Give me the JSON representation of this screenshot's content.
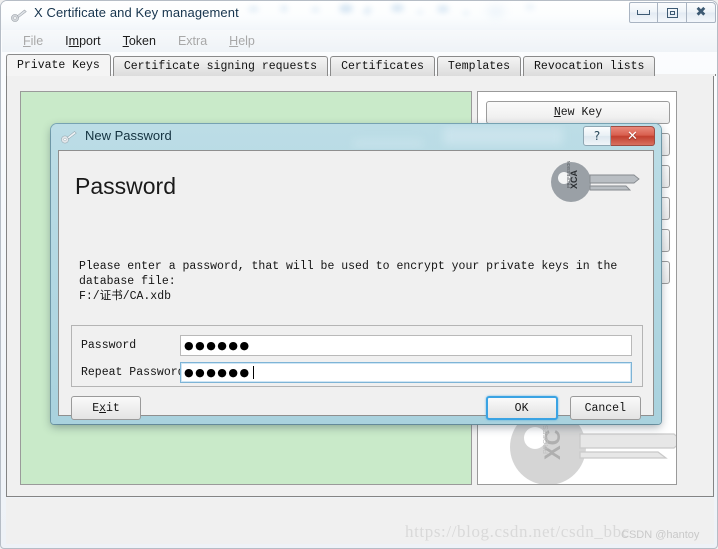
{
  "window": {
    "title": "X Certificate and Key management",
    "icon": "key-icon",
    "controls": {
      "minimize": "minimize-icon",
      "maximize": "maximize-icon",
      "close": "close-icon"
    }
  },
  "menubar": {
    "items": [
      {
        "label": "File",
        "mnemonic": "F",
        "enabled": false
      },
      {
        "label": "Import",
        "mnemonic": "m",
        "enabled": true
      },
      {
        "label": "Token",
        "mnemonic": "T",
        "enabled": true
      },
      {
        "label": "Extra",
        "mnemonic": "E",
        "enabled": false
      },
      {
        "label": "Help",
        "mnemonic": "H",
        "enabled": false
      }
    ]
  },
  "tabs": [
    {
      "label": "Private Keys",
      "active": true
    },
    {
      "label": "Certificate signing requests",
      "active": false
    },
    {
      "label": "Certificates",
      "active": false
    },
    {
      "label": "Templates",
      "active": false
    },
    {
      "label": "Revocation lists",
      "active": false
    }
  ],
  "main": {
    "key_list": {
      "name": "private-key-list",
      "items": [],
      "background": "#c9eac9"
    },
    "side_buttons": [
      {
        "label": "New Key",
        "mnemonic": "N",
        "visible": true
      },
      {
        "label": "",
        "visible": false
      },
      {
        "label": "",
        "visible": false
      },
      {
        "label": "",
        "visible": false
      },
      {
        "label": "",
        "visible": false
      },
      {
        "label": "",
        "visible": false
      }
    ],
    "watermark_graphic": "xca-key-graphic"
  },
  "dialog": {
    "title": "New Password",
    "icon": "key-icon",
    "help_button": "?",
    "close_button": "✕",
    "heading": "Password",
    "header_icon": "xca-key-icon",
    "description": "Please enter a password, that will be used to encrypt your private keys in the database file:\nF:/证书/CA.xdb",
    "fields": [
      {
        "label": "Password",
        "value": "●●●●●●",
        "char_count": 6,
        "focused": false
      },
      {
        "label": "Repeat Password",
        "value": "●●●●●●",
        "char_count": 6,
        "focused": true
      }
    ],
    "buttons": {
      "exit": {
        "label": "Exit",
        "mnemonic": "x",
        "default": false
      },
      "ok": {
        "label": "OK",
        "default": true
      },
      "cancel": {
        "label": "Cancel",
        "default": false
      }
    },
    "accent": "#3aa3e3",
    "titlebar_color": "#a9d2de"
  },
  "watermarks": {
    "url": "https://blog.csdn.net/csdn_bbc",
    "tag": "CSDN @hantoy"
  }
}
